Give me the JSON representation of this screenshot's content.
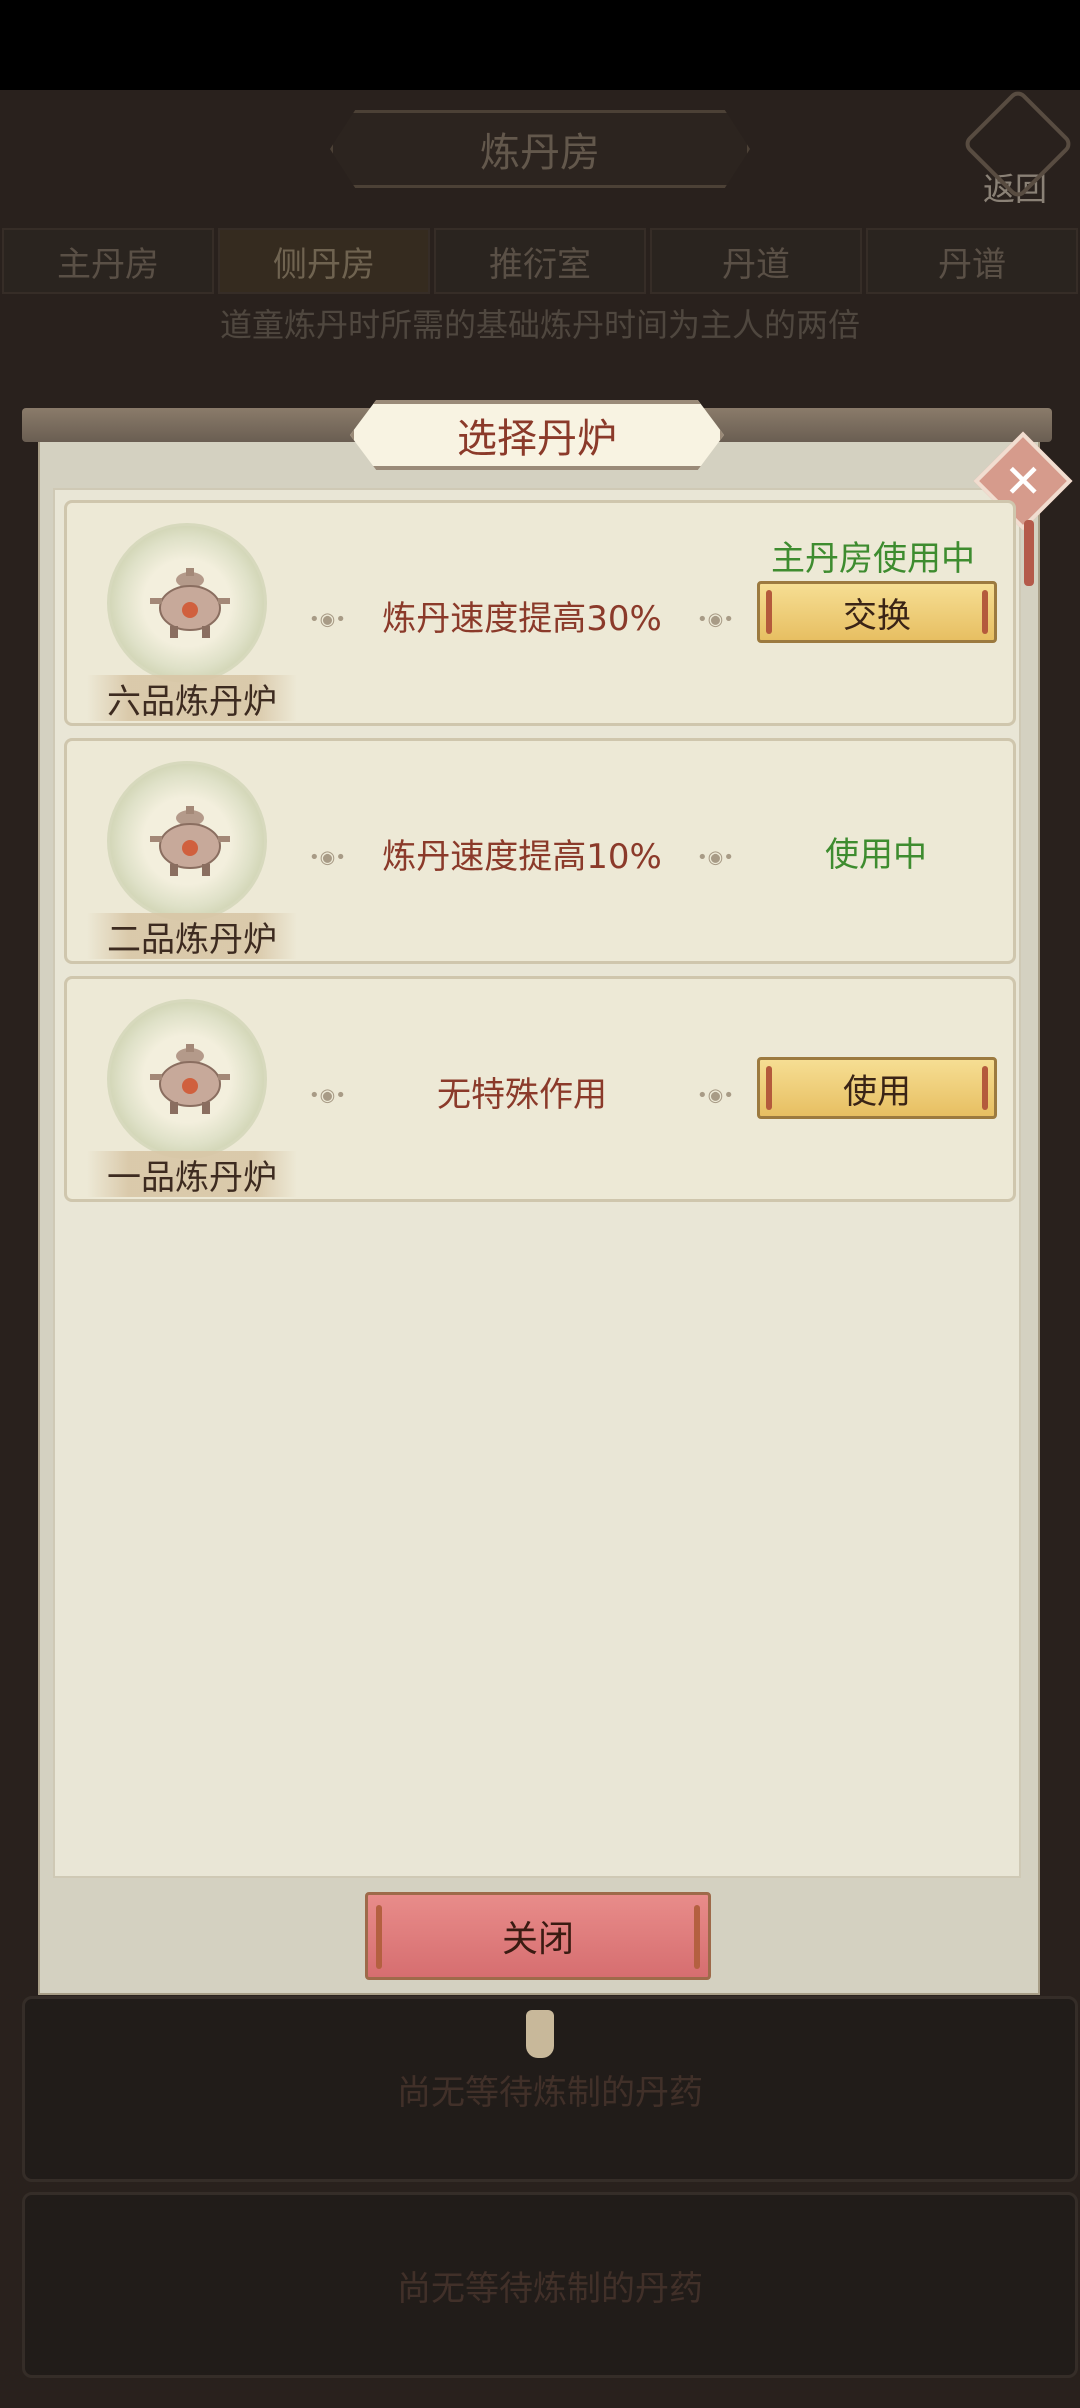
{
  "header": {
    "title": "炼丹房",
    "back_label": "返回"
  },
  "tabs": [
    {
      "label": "主丹房"
    },
    {
      "label": "侧丹房"
    },
    {
      "label": "推衍室"
    },
    {
      "label": "丹道"
    },
    {
      "label": "丹谱"
    }
  ],
  "notice": "道童炼丹时所需的基础炼丹时间为主人的两倍",
  "background_cards": [
    "尚无等待炼制的丹药",
    "尚无等待炼制的丹药"
  ],
  "modal": {
    "title": "选择丹炉",
    "close_label": "关闭",
    "rows": [
      {
        "name": "六品炼丹炉",
        "effect": "炼丹速度提高30%",
        "status": "主丹房使用中",
        "button": "交换"
      },
      {
        "name": "二品炼丹炉",
        "effect": "炼丹速度提高10%",
        "status": "使用中"
      },
      {
        "name": "一品炼丹炉",
        "effect": "无特殊作用",
        "button": "使用"
      }
    ]
  },
  "colors": {
    "status_green": "#3e8c2f",
    "effect_red": "#8b3a2a",
    "button_gold": "#f0cf7a",
    "close_red": "#e07d7e"
  }
}
